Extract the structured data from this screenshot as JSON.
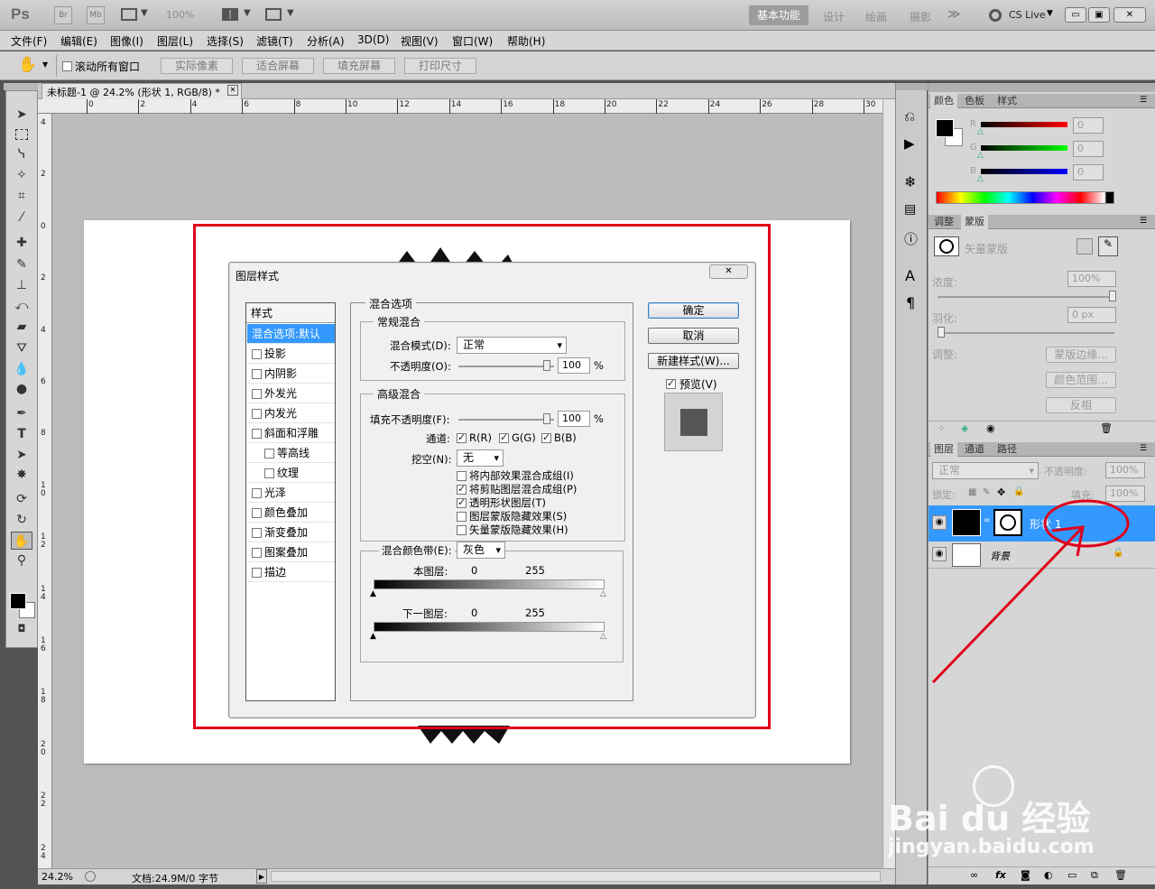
{
  "titlebar": {
    "logo": "Ps",
    "br": "Br",
    "mb": "Mb",
    "zoom": "100%",
    "workspaces": [
      "基本功能",
      "设计",
      "绘画",
      "摄影"
    ],
    "more": "≫",
    "cslive": "CS Live",
    "win_min": "▭",
    "win_max": "▣",
    "win_close": "✕"
  },
  "menu": [
    "文件(F)",
    "编辑(E)",
    "图像(I)",
    "图层(L)",
    "选择(S)",
    "滤镜(T)",
    "分析(A)",
    "3D(D)",
    "视图(V)",
    "窗口(W)",
    "帮助(H)"
  ],
  "options": {
    "scroll_all": "滚动所有窗口",
    "buttons": [
      "实际像素",
      "适合屏幕",
      "填充屏幕",
      "打印尺寸"
    ]
  },
  "document": {
    "tab_title": "未标题-1 @ 24.2% (形状 1, RGB/8) *",
    "tab_close": "✕",
    "ruler_h": [
      "0",
      "2",
      "4",
      "6",
      "8",
      "10",
      "12",
      "14",
      "16",
      "18",
      "20",
      "22",
      "24",
      "26",
      "28",
      "30"
    ],
    "ruler_v": [
      "4",
      "2",
      "0",
      "2",
      "4",
      "6",
      "8",
      "1 0",
      "1 2",
      "1 4",
      "1 6",
      "1 8",
      "2 0",
      "2 2",
      "2 4"
    ],
    "zoom": "24.2%",
    "doc_info": "文档:24.9M/0 字节"
  },
  "dialog": {
    "title": "图层样式",
    "close": "✕",
    "styles_header": "样式",
    "styles": [
      {
        "label": "混合选项:默认",
        "checkbox": false,
        "selected": true,
        "indent": false
      },
      {
        "label": "投影",
        "checkbox": true,
        "checked": false,
        "indent": false
      },
      {
        "label": "内阴影",
        "checkbox": true,
        "checked": false,
        "indent": false
      },
      {
        "label": "外发光",
        "checkbox": true,
        "checked": false,
        "indent": false
      },
      {
        "label": "内发光",
        "checkbox": true,
        "checked": false,
        "indent": false
      },
      {
        "label": "斜面和浮雕",
        "checkbox": true,
        "checked": false,
        "indent": false
      },
      {
        "label": "等高线",
        "checkbox": true,
        "checked": false,
        "indent": true
      },
      {
        "label": "纹理",
        "checkbox": true,
        "checked": false,
        "indent": true
      },
      {
        "label": "光泽",
        "checkbox": true,
        "checked": false,
        "indent": false
      },
      {
        "label": "颜色叠加",
        "checkbox": true,
        "checked": false,
        "indent": false
      },
      {
        "label": "渐变叠加",
        "checkbox": true,
        "checked": false,
        "indent": false
      },
      {
        "label": "图案叠加",
        "checkbox": true,
        "checked": false,
        "indent": false
      },
      {
        "label": "描边",
        "checkbox": true,
        "checked": false,
        "indent": false
      }
    ],
    "blending_options": "混合选项",
    "general_blending": "常规混合",
    "blend_mode_label": "混合模式(D):",
    "blend_mode_value": "正常",
    "opacity_label": "不透明度(O):",
    "opacity_value": "100",
    "percent": "%",
    "advanced_blending": "高级混合",
    "fill_opacity_label": "填充不透明度(F):",
    "fill_opacity_value": "100",
    "channels_label": "通道:",
    "channel_r": "R(R)",
    "channel_g": "G(G)",
    "channel_b": "B(B)",
    "knockout_label": "挖空(N):",
    "knockout_value": "无",
    "adv_options": [
      {
        "label": "将内部效果混合成组(I)",
        "checked": false
      },
      {
        "label": "将剪贴图层混合成组(P)",
        "checked": true
      },
      {
        "label": "透明形状图层(T)",
        "checked": true
      },
      {
        "label": "图层蒙版隐藏效果(S)",
        "checked": false
      },
      {
        "label": "矢量蒙版隐藏效果(H)",
        "checked": false
      }
    ],
    "blend_if_label": "混合颜色带(E):",
    "blend_if_value": "灰色",
    "this_layer": "本图层:",
    "underlying_layer": "下一图层:",
    "range_min": "0",
    "range_max": "255",
    "ok": "确定",
    "cancel": "取消",
    "new_style": "新建样式(W)...",
    "preview": "预览(V)"
  },
  "color_panel": {
    "tabs": [
      "颜色",
      "色板",
      "样式"
    ],
    "labels": [
      "R",
      "G",
      "B"
    ],
    "values": [
      "0",
      "0",
      "0"
    ]
  },
  "masks_panel": {
    "tabs": [
      "调整",
      "蒙版"
    ],
    "vector_mask": "矢量蒙版",
    "density_label": "浓度:",
    "density_value": "100%",
    "feather_label": "羽化:",
    "feather_value": "0 px",
    "refine_label": "调整:",
    "buttons": [
      "蒙版边缘...",
      "颜色范围...",
      "反相"
    ]
  },
  "layers_panel": {
    "tabs": [
      "图层",
      "通道",
      "路径"
    ],
    "blend_mode": "正常",
    "opacity_label": "不透明度:",
    "opacity_value": "100%",
    "lock_label": "锁定:",
    "fill_label": "填充:",
    "fill_value": "100%",
    "layers": [
      {
        "name": "形状 1",
        "selected": true
      },
      {
        "name": "背景",
        "selected": false
      }
    ],
    "footer_fx": "fx"
  },
  "watermark": {
    "brand": "Bai du 经验",
    "url": "jingyan.baidu.com"
  },
  "colors": {
    "highlight": "#3399ff",
    "annotation": "#e0001a"
  }
}
